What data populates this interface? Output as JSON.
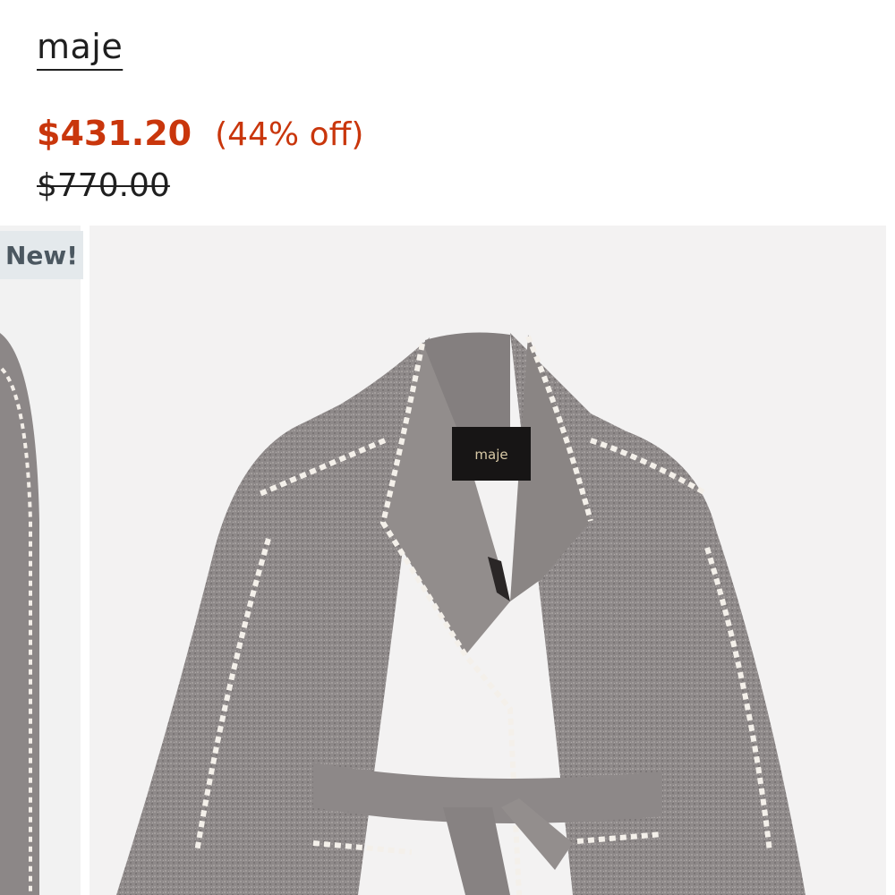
{
  "product": {
    "brand": "maje",
    "sale_price": "$431.20",
    "discount": "(44% off)",
    "original_price": "$770.00",
    "badge": "New!",
    "label_text": "maje"
  },
  "colors": {
    "sale": "#c9360c",
    "text": "#1f1f1f",
    "badge_bg": "#e4e9ec",
    "coat": "#8f8a8a",
    "trim": "#f4f0ea"
  },
  "icons": {
    "image": "product-image"
  }
}
